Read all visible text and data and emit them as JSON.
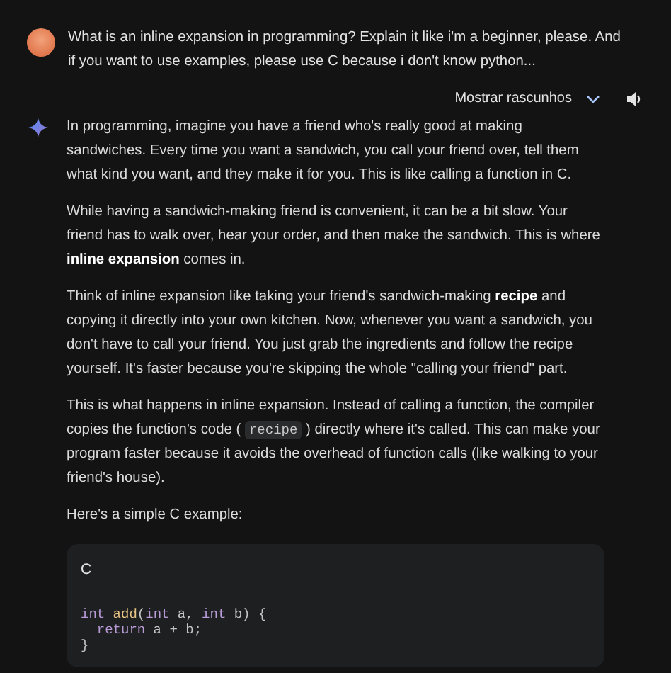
{
  "user_prompt": {
    "text": "What is an inline expansion in programming? Explain it like i'm a beginner, please. And if you want to use examples, please use C because i don't know python..."
  },
  "response_toolbar": {
    "drafts_button": "Mostrar rascunhos",
    "expanded": false
  },
  "response": {
    "paragraphs": [
      [
        {
          "kind": "text",
          "text": "In programming, imagine you have a friend who's really good at making sandwiches. Every time you want a sandwich, you call your friend over, tell them what kind you want, and they make it for you. This is like calling a function in C."
        }
      ],
      [
        {
          "kind": "text",
          "text": "While having a sandwich-making friend is convenient, it can be a bit slow. Your friend has to walk over, hear your order, and then make the sandwich. This is where **inline expansion** comes in."
        }
      ],
      [
        {
          "kind": "text",
          "text": "Think of inline expansion like taking your friend's sandwich-making **recipe** and copying it directly into your own kitchen. Now, whenever you want a sandwich, you don't have to call your friend. You just grab the ingredients and follow the recipe yourself. It's faster because you're skipping the whole \"calling your friend\" part."
        }
      ],
      [
        {
          "kind": "text",
          "text": "This is what happens in inline expansion. Instead of calling a function, the compiler copies the function's code ("
        },
        {
          "kind": "code",
          "text": "recipe"
        },
        {
          "kind": "text",
          "text": ") directly where it's called. This can make your program faster because it avoids the overhead of function calls (like walking to your friend's house)."
        }
      ],
      [
        {
          "kind": "text",
          "text": "Here's a simple C example:"
        }
      ]
    ],
    "code_block": {
      "language": "C",
      "lines": [
        [
          {
            "kind": "keyword",
            "text": "int"
          },
          {
            "kind": "function",
            "text": " add"
          },
          {
            "kind": "plain",
            "text": "("
          },
          {
            "kind": "keyword",
            "text": "int"
          },
          {
            "kind": "plain",
            "text": " a, "
          },
          {
            "kind": "keyword",
            "text": "int"
          },
          {
            "kind": "plain",
            "text": " b) {"
          }
        ],
        [
          {
            "kind": "keyword",
            "text": "  return"
          },
          {
            "kind": "plain",
            "text": " a + b;"
          }
        ],
        [
          {
            "kind": "plain",
            "text": "}"
          }
        ]
      ]
    }
  }
}
